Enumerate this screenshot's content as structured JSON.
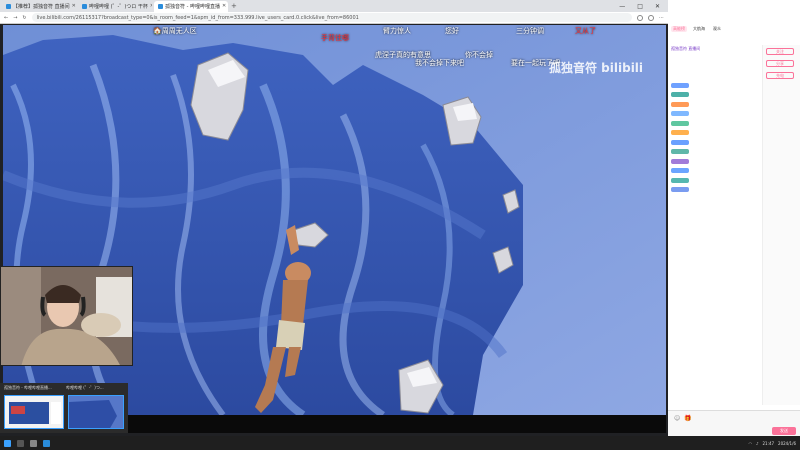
{
  "browser": {
    "tabs": [
      {
        "title": "【推荐】孤独音符 直播间"
      },
      {
        "title": "哔哩哔哩 (゜-゜)つロ 干杯"
      },
      {
        "title": "孤独音符 - 哔哩哔哩直播"
      }
    ],
    "new_tab": "+",
    "url": "live.bilibili.com/26115317?broadcast_type=0&is_room_feed=1&spm_id_from=333.999.live_users_card.0.click&live_from=86001",
    "window_controls": [
      "—",
      "□",
      "✕"
    ]
  },
  "video": {
    "top_labels": [
      {
        "text": "🏠周周无人区",
        "color": "white"
      },
      {
        "text": "手背往哪",
        "color": "red"
      },
      {
        "text": "臂力惊人",
        "color": "white"
      },
      {
        "text": "您好",
        "color": "white"
      },
      {
        "text": "三分钟调",
        "color": "white"
      },
      {
        "text": "又从了",
        "color": "red"
      }
    ],
    "danmaku": [
      "虎涅子真的有意思",
      "我不会掉下来吧",
      "你不会掉",
      "要在一起玩了吧"
    ],
    "watermark": "孤独音符 bilibili"
  },
  "preview": {
    "items": [
      {
        "label": "孤独音符 - 哔哩哔哩直播..."
      },
      {
        "label": "哔哩哔哩 (゜-゜)つ..."
      }
    ]
  },
  "chat": {
    "header_tabs": [
      "高能榜",
      "大航海",
      "观众"
    ],
    "room_info": "孤独音符 直播间",
    "sidebar_buttons": [
      "关注",
      "分享",
      "充电"
    ],
    "send_label": "发送",
    "accent": "#fb7299"
  },
  "taskbar": {
    "time": "21:47",
    "date": "2024/1/6"
  }
}
